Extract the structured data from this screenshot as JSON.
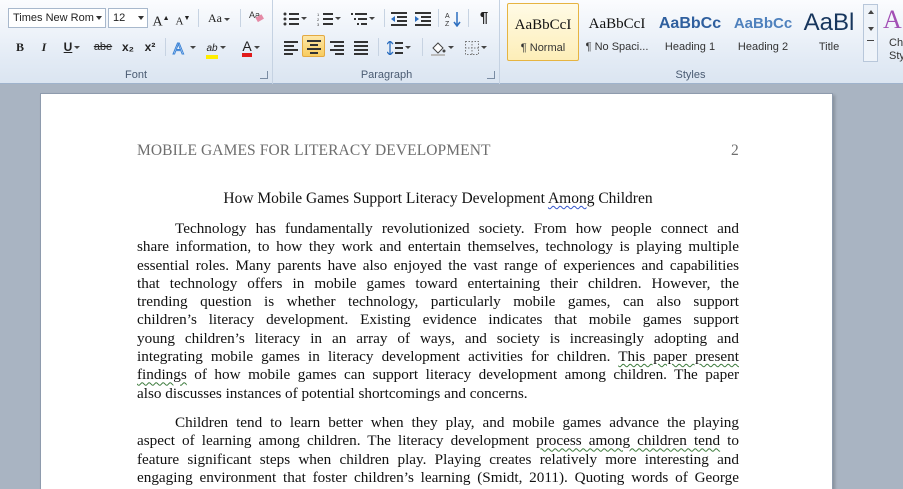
{
  "ribbon": {
    "font": {
      "label": "Font",
      "family": "Times New Rom",
      "size": "12",
      "grow": "A",
      "shrink": "A",
      "change_case": "Aa",
      "bold": "B",
      "italic": "I",
      "underline": "U",
      "strike": "abe",
      "subscript": "x₂",
      "superscript": "x²",
      "highlight": "ab",
      "font_color": "A"
    },
    "paragraph": {
      "label": "Paragraph",
      "pilcrow": "¶"
    },
    "styles": {
      "label": "Styles",
      "tiles": [
        {
          "sample": "AaBbCcI",
          "name": "¶ Normal"
        },
        {
          "sample": "AaBbCcI",
          "name": "¶ No Spaci..."
        },
        {
          "sample": "AaBbCc",
          "name": "Heading 1"
        },
        {
          "sample": "AaBbCc",
          "name": "Heading 2"
        },
        {
          "sample": "AaBl",
          "name": "Title"
        }
      ],
      "change_styles_top": "Ch",
      "change_styles_bottom": "Sty"
    }
  },
  "document": {
    "header": "MOBILE GAMES FOR LITERACY DEVELOPMENT",
    "page_number": "2",
    "title_before": "How Mobile Games Support Literacy Development ",
    "title_flag": "Among",
    "title_after": " Children",
    "p1": {
      "l1": "Technology has fundamentally revolutionized society. From how people connect and",
      "l2": "share information, to how they work and entertain themselves, technology is playing multiple",
      "l3": "essential roles. Many parents have also enjoyed the vast range of experiences and capabilities",
      "l4": "that technology offers in mobile games toward entertaining their children. However, the",
      "l5": "trending question is whether technology, particularly mobile games, can also support",
      "l6": "children’s literacy development. Existing evidence indicates that mobile games support",
      "l7": "young children’s literacy in an array of ways, and society is increasingly adopting and",
      "l8a": "integrating mobile games in literacy development activities for children. ",
      "l8b": "This paper present",
      "l9a": "findings",
      "l9b": " of how mobile games can support literacy development among children. The paper",
      "l10": "also discusses instances of potential shortcomings and concerns."
    },
    "p2": {
      "l1": "Children tend to learn better when they play, and mobile games advance the playing",
      "l2a": "aspect of learning among children. The literacy development ",
      "l2b": "process among children tend",
      "l2c": " to",
      "l3": "feature significant steps when children play. Playing creates relatively more interesting and",
      "l4": "engaging environment that foster children’s learning (Smidt, 2011). Quoting words of George"
    }
  }
}
